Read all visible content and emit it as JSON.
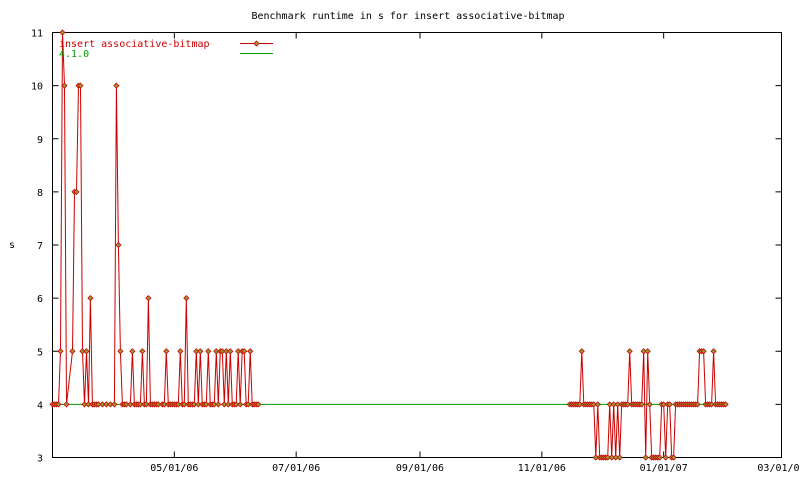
{
  "chart_data": {
    "type": "line",
    "title": "Benchmark runtime in s for insert associative-bitmap",
    "ylabel": "s",
    "xlabel": "",
    "ylim": [
      3,
      11
    ],
    "yticks": [
      3,
      4,
      5,
      6,
      7,
      8,
      9,
      10,
      11
    ],
    "xlim": [
      "2006-03-01",
      "2007-03-01"
    ],
    "xticks": [
      {
        "date": "2006-05-01",
        "label": "05/01/06"
      },
      {
        "date": "2006-07-01",
        "label": "07/01/06"
      },
      {
        "date": "2006-09-01",
        "label": "09/01/06"
      },
      {
        "date": "2006-11-01",
        "label": "11/01/06"
      },
      {
        "date": "2007-01-01",
        "label": "01/01/07"
      },
      {
        "date": "2007-03-01",
        "label": "03/01/07"
      }
    ],
    "grid": false,
    "legend_position": "top-left",
    "colors": {
      "series": "#cc0000",
      "baseline": "#009900",
      "marker": "#999933",
      "axes": "#000000"
    },
    "series": [
      {
        "name": "insert associative-bitmap",
        "style": "linespoints",
        "points": [
          [
            "2006-03-01",
            4
          ],
          [
            "2006-03-02",
            4
          ],
          [
            "2006-03-03",
            4
          ],
          [
            "2006-03-04",
            4
          ],
          [
            "2006-03-05",
            5
          ],
          [
            "2006-03-06",
            11
          ],
          [
            "2006-03-07",
            10
          ],
          [
            "2006-03-08",
            4
          ],
          [
            "2006-03-11",
            5
          ],
          [
            "2006-03-12",
            8
          ],
          [
            "2006-03-13",
            8
          ],
          [
            "2006-03-14",
            10
          ],
          [
            "2006-03-15",
            10
          ],
          [
            "2006-03-16",
            5
          ],
          [
            "2006-03-17",
            4
          ],
          [
            "2006-03-18",
            5
          ],
          [
            "2006-03-19",
            4
          ],
          [
            "2006-03-20",
            6
          ],
          [
            "2006-03-21",
            4
          ],
          [
            "2006-03-22",
            4
          ],
          [
            "2006-03-23",
            4
          ],
          [
            "2006-03-24",
            4
          ],
          [
            "2006-03-26",
            4
          ],
          [
            "2006-03-28",
            4
          ],
          [
            "2006-03-30",
            4
          ],
          [
            "2006-04-01",
            4
          ],
          [
            "2006-04-02",
            10
          ],
          [
            "2006-04-03",
            7
          ],
          [
            "2006-04-04",
            5
          ],
          [
            "2006-04-05",
            4
          ],
          [
            "2006-04-06",
            4
          ],
          [
            "2006-04-07",
            4
          ],
          [
            "2006-04-09",
            4
          ],
          [
            "2006-04-10",
            5
          ],
          [
            "2006-04-11",
            4
          ],
          [
            "2006-04-12",
            4
          ],
          [
            "2006-04-13",
            4
          ],
          [
            "2006-04-14",
            4
          ],
          [
            "2006-04-15",
            5
          ],
          [
            "2006-04-16",
            4
          ],
          [
            "2006-04-17",
            4
          ],
          [
            "2006-04-18",
            6
          ],
          [
            "2006-04-19",
            4
          ],
          [
            "2006-04-20",
            4
          ],
          [
            "2006-04-21",
            4
          ],
          [
            "2006-04-22",
            4
          ],
          [
            "2006-04-23",
            4
          ],
          [
            "2006-04-25",
            4
          ],
          [
            "2006-04-26",
            4
          ],
          [
            "2006-04-27",
            5
          ],
          [
            "2006-04-28",
            4
          ],
          [
            "2006-04-29",
            4
          ],
          [
            "2006-04-30",
            4
          ],
          [
            "2006-05-01",
            4
          ],
          [
            "2006-05-02",
            4
          ],
          [
            "2006-05-03",
            4
          ],
          [
            "2006-05-04",
            5
          ],
          [
            "2006-05-05",
            4
          ],
          [
            "2006-05-06",
            4
          ],
          [
            "2006-05-07",
            6
          ],
          [
            "2006-05-08",
            4
          ],
          [
            "2006-05-09",
            4
          ],
          [
            "2006-05-10",
            4
          ],
          [
            "2006-05-11",
            4
          ],
          [
            "2006-05-12",
            5
          ],
          [
            "2006-05-13",
            4
          ],
          [
            "2006-05-14",
            5
          ],
          [
            "2006-05-15",
            4
          ],
          [
            "2006-05-16",
            4
          ],
          [
            "2006-05-17",
            4
          ],
          [
            "2006-05-18",
            5
          ],
          [
            "2006-05-19",
            4
          ],
          [
            "2006-05-20",
            4
          ],
          [
            "2006-05-21",
            4
          ],
          [
            "2006-05-22",
            5
          ],
          [
            "2006-05-23",
            4
          ],
          [
            "2006-05-24",
            5
          ],
          [
            "2006-05-25",
            5
          ],
          [
            "2006-05-26",
            4
          ],
          [
            "2006-05-27",
            5
          ],
          [
            "2006-05-28",
            4
          ],
          [
            "2006-05-29",
            5
          ],
          [
            "2006-05-30",
            4
          ],
          [
            "2006-05-31",
            4
          ],
          [
            "2006-06-01",
            4
          ],
          [
            "2006-06-02",
            5
          ],
          [
            "2006-06-03",
            4
          ],
          [
            "2006-06-04",
            5
          ],
          [
            "2006-06-05",
            5
          ],
          [
            "2006-06-06",
            4
          ],
          [
            "2006-06-07",
            4
          ],
          [
            "2006-06-08",
            5
          ],
          [
            "2006-06-09",
            4
          ],
          [
            "2006-06-10",
            4
          ],
          [
            "2006-06-11",
            4
          ],
          [
            "2006-06-12",
            4
          ],
          [
            "2006-11-15",
            4
          ],
          [
            "2006-11-16",
            4
          ],
          [
            "2006-11-17",
            4
          ],
          [
            "2006-11-18",
            4
          ],
          [
            "2006-11-19",
            4
          ],
          [
            "2006-11-20",
            4
          ],
          [
            "2006-11-21",
            5
          ],
          [
            "2006-11-22",
            4
          ],
          [
            "2006-11-23",
            4
          ],
          [
            "2006-11-24",
            4
          ],
          [
            "2006-11-25",
            4
          ],
          [
            "2006-11-26",
            4
          ],
          [
            "2006-11-27",
            4
          ],
          [
            "2006-11-28",
            3
          ],
          [
            "2006-11-29",
            4
          ],
          [
            "2006-11-30",
            3
          ],
          [
            "2006-12-01",
            3
          ],
          [
            "2006-12-02",
            3
          ],
          [
            "2006-12-03",
            3
          ],
          [
            "2006-12-04",
            3
          ],
          [
            "2006-12-05",
            4
          ],
          [
            "2006-12-06",
            3
          ],
          [
            "2006-12-07",
            4
          ],
          [
            "2006-12-08",
            3
          ],
          [
            "2006-12-09",
            4
          ],
          [
            "2006-12-10",
            3
          ],
          [
            "2006-12-11",
            4
          ],
          [
            "2006-12-12",
            4
          ],
          [
            "2006-12-13",
            4
          ],
          [
            "2006-12-14",
            4
          ],
          [
            "2006-12-15",
            5
          ],
          [
            "2006-12-16",
            4
          ],
          [
            "2006-12-17",
            4
          ],
          [
            "2006-12-18",
            4
          ],
          [
            "2006-12-19",
            4
          ],
          [
            "2006-12-20",
            4
          ],
          [
            "2006-12-21",
            4
          ],
          [
            "2006-12-22",
            5
          ],
          [
            "2006-12-23",
            3
          ],
          [
            "2006-12-24",
            5
          ],
          [
            "2006-12-25",
            4
          ],
          [
            "2006-12-26",
            3
          ],
          [
            "2006-12-27",
            3
          ],
          [
            "2006-12-28",
            3
          ],
          [
            "2006-12-29",
            3
          ],
          [
            "2006-12-30",
            3
          ],
          [
            "2006-12-31",
            4
          ],
          [
            "2007-01-01",
            4
          ],
          [
            "2007-01-02",
            3
          ],
          [
            "2007-01-03",
            4
          ],
          [
            "2007-01-04",
            4
          ],
          [
            "2007-01-05",
            3
          ],
          [
            "2007-01-06",
            3
          ],
          [
            "2007-01-07",
            4
          ],
          [
            "2007-01-08",
            4
          ],
          [
            "2007-01-09",
            4
          ],
          [
            "2007-01-10",
            4
          ],
          [
            "2007-01-11",
            4
          ],
          [
            "2007-01-12",
            4
          ],
          [
            "2007-01-13",
            4
          ],
          [
            "2007-01-14",
            4
          ],
          [
            "2007-01-15",
            4
          ],
          [
            "2007-01-16",
            4
          ],
          [
            "2007-01-17",
            4
          ],
          [
            "2007-01-18",
            4
          ],
          [
            "2007-01-19",
            5
          ],
          [
            "2007-01-20",
            5
          ],
          [
            "2007-01-21",
            5
          ],
          [
            "2007-01-22",
            4
          ],
          [
            "2007-01-23",
            4
          ],
          [
            "2007-01-24",
            4
          ],
          [
            "2007-01-25",
            4
          ],
          [
            "2007-01-26",
            5
          ],
          [
            "2007-01-27",
            4
          ],
          [
            "2007-01-28",
            4
          ],
          [
            "2007-01-29",
            4
          ],
          [
            "2007-01-30",
            4
          ],
          [
            "2007-01-31",
            4
          ],
          [
            "2007-02-01",
            4
          ]
        ]
      },
      {
        "name": "4.1.0",
        "style": "line",
        "points": [
          [
            "2006-03-01",
            4
          ],
          [
            "2007-02-01",
            4
          ]
        ]
      }
    ]
  }
}
